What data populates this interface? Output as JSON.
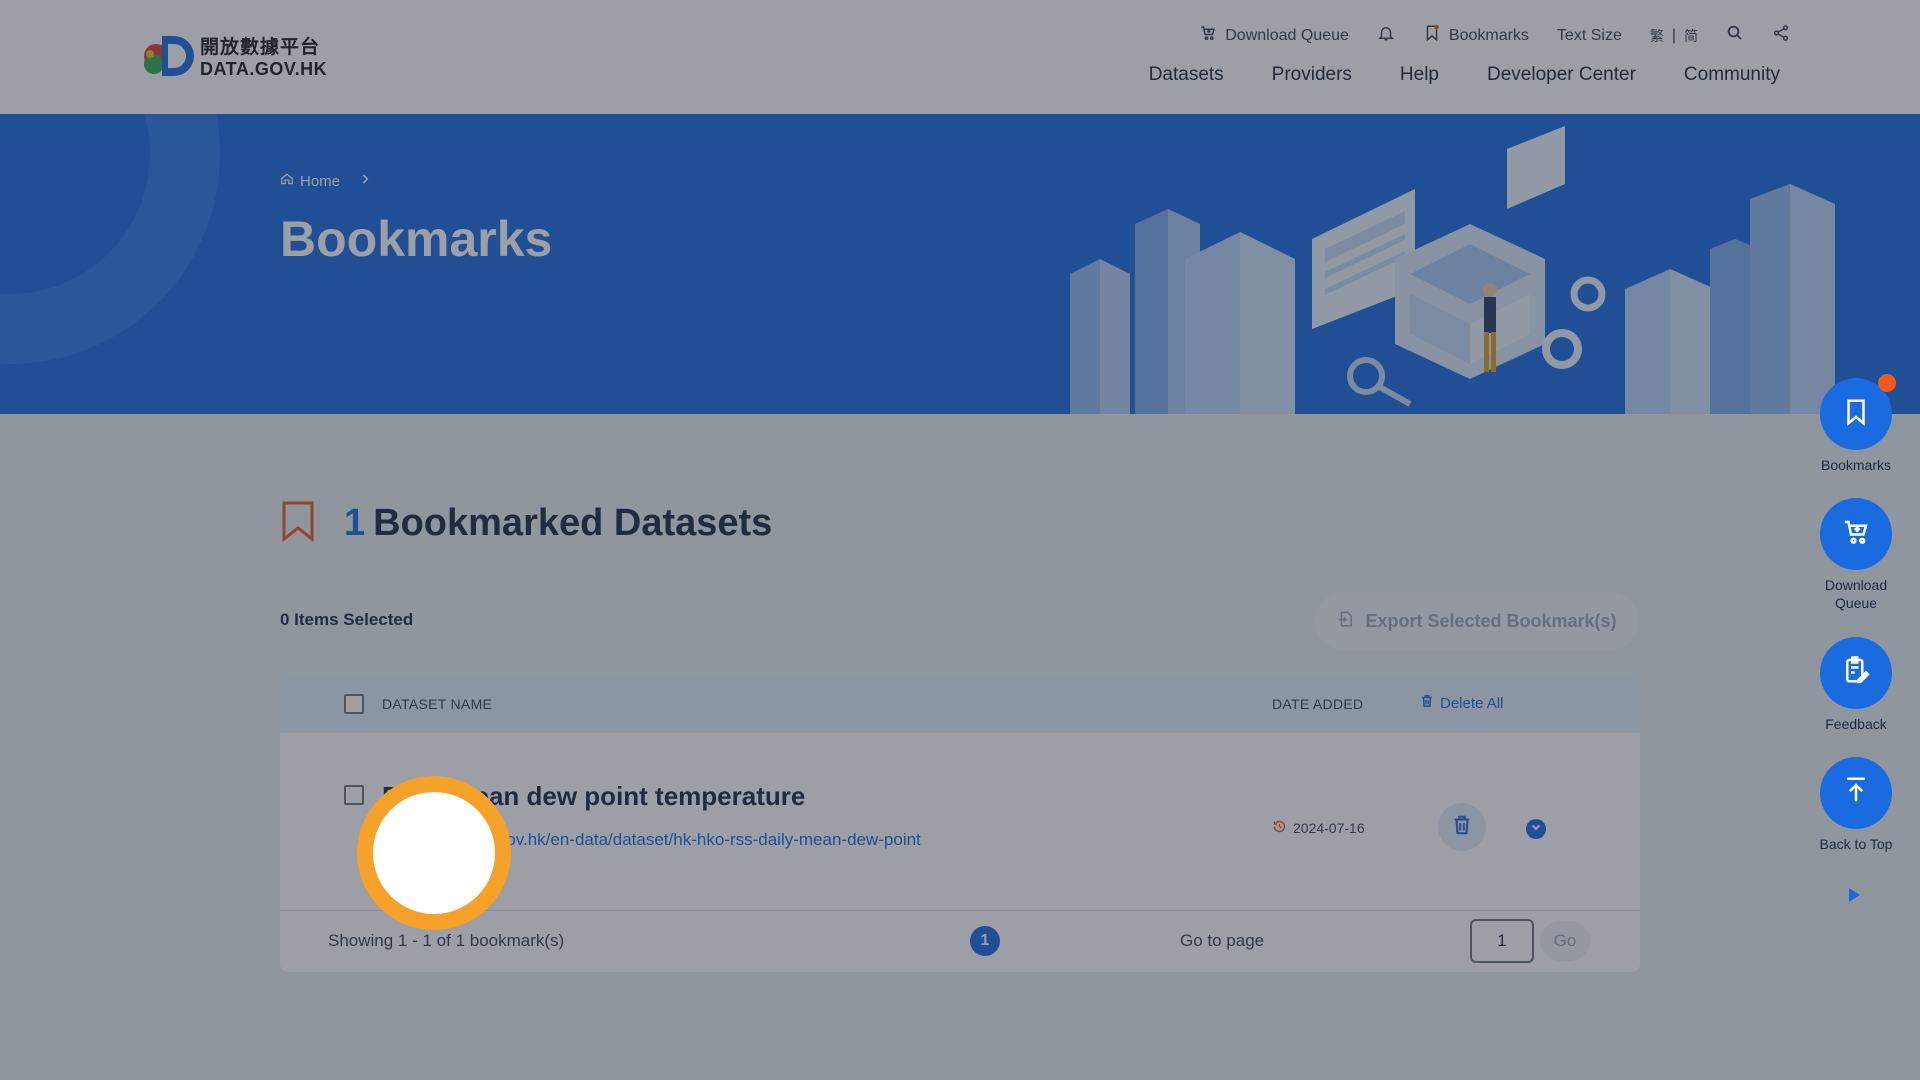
{
  "header": {
    "logo_zh": "開放數據平台",
    "logo_en": "DATA.GOV.HK",
    "utility": {
      "download_queue": "Download Queue",
      "bookmarks": "Bookmarks",
      "text_size": "Text Size",
      "lang_trad": "繁",
      "lang_sep": "|",
      "lang_simp": "简"
    },
    "nav": [
      "Datasets",
      "Providers",
      "Help",
      "Developer Center",
      "Community"
    ]
  },
  "banner": {
    "breadcrumb_home": "Home",
    "title": "Bookmarks"
  },
  "section": {
    "count": "1",
    "label": "Bookmarked Datasets"
  },
  "toolbar": {
    "selected_text": "0 Items Selected",
    "export_label": "Export Selected Bookmark(s)"
  },
  "table": {
    "col_name": "DATASET NAME",
    "col_date": "DATE ADDED",
    "delete_all": "Delete All",
    "rows": [
      {
        "title": "Daily mean dew point temperature",
        "url": "https://data.gov.hk/en-data/dataset/hk-hko-rss-daily-mean-dew-point",
        "date": "2024-07-16"
      }
    ],
    "footer": {
      "showing": "Showing 1 - 1 of 1 bookmark(s)",
      "current_page": "1",
      "goto_label": "Go to page",
      "goto_value": "1",
      "go_button": "Go"
    }
  },
  "side_buttons": {
    "bookmarks": "Bookmarks",
    "download_queue": "Download Queue",
    "feedback": "Feedback",
    "back_to_top": "Back to Top"
  },
  "colors": {
    "brand_blue": "#1a6ae0",
    "accent_orange": "#f05a1e",
    "spotlight_ring": "#f6a12a"
  }
}
